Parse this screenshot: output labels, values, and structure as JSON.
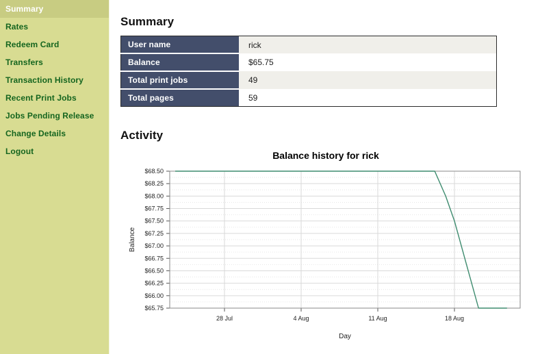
{
  "sidebar": {
    "items": [
      {
        "label": "Summary",
        "name": "sidebar-item-summary",
        "selected": true
      },
      {
        "label": "Rates",
        "name": "sidebar-item-rates",
        "selected": false
      },
      {
        "label": "Redeem Card",
        "name": "sidebar-item-redeem-card",
        "selected": false
      },
      {
        "label": "Transfers",
        "name": "sidebar-item-transfers",
        "selected": false
      },
      {
        "label": "Transaction History",
        "name": "sidebar-item-transaction-history",
        "selected": false
      },
      {
        "label": "Recent Print Jobs",
        "name": "sidebar-item-recent-print-jobs",
        "selected": false
      },
      {
        "label": "Jobs Pending Release",
        "name": "sidebar-item-jobs-pending-release",
        "selected": false
      },
      {
        "label": "Change Details",
        "name": "sidebar-item-change-details",
        "selected": false
      },
      {
        "label": "Logout",
        "name": "sidebar-item-logout",
        "selected": false
      }
    ]
  },
  "main": {
    "summary_heading": "Summary",
    "activity_heading": "Activity",
    "summary_table": {
      "rows": [
        {
          "key": "User name",
          "value": "rick"
        },
        {
          "key": "Balance",
          "value": "$65.75"
        },
        {
          "key": "Total print jobs",
          "value": "49"
        },
        {
          "key": "Total pages",
          "value": "59"
        }
      ]
    }
  },
  "colors": {
    "sidebar_bg": "#d8dc92",
    "sidebar_selected_bg": "#c8cc82",
    "sidebar_link": "#15651f",
    "table_header_bg": "#434e6b",
    "table_row_alt_bg": "#f0efea",
    "chart_line": "#3d8b6e",
    "grid_major": "#d9d9d9",
    "grid_minor": "#e6e6e6"
  },
  "chart_data": {
    "type": "line",
    "title": "Balance history for rick",
    "xlabel": "Day",
    "ylabel": "Balance",
    "grid": true,
    "legend": "none",
    "ylim": [
      65.75,
      68.5
    ],
    "ytick_labels": [
      "$68.50",
      "$68.25",
      "$68.00",
      "$67.75",
      "$67.50",
      "$67.25",
      "$67.00",
      "$66.75",
      "$66.50",
      "$66.25",
      "$66.00",
      "$65.75"
    ],
    "ytick_values": [
      68.5,
      68.25,
      68.0,
      67.75,
      67.5,
      67.25,
      67.0,
      66.75,
      66.5,
      66.25,
      66.0,
      65.75
    ],
    "xtick_labels": [
      "28 Jul",
      "4 Aug",
      "11 Aug",
      "18 Aug"
    ],
    "xtick_positions": [
      28,
      35,
      42,
      49
    ],
    "xlim": [
      23,
      55
    ],
    "series": [
      {
        "name": "Balance",
        "x": [
          23.5,
          47.2,
          48.2,
          49.0,
          51.2,
          53.8
        ],
        "y": [
          68.5,
          68.5,
          68.0,
          67.5,
          65.75,
          65.75
        ],
        "color": "#3d8b6e"
      }
    ]
  }
}
